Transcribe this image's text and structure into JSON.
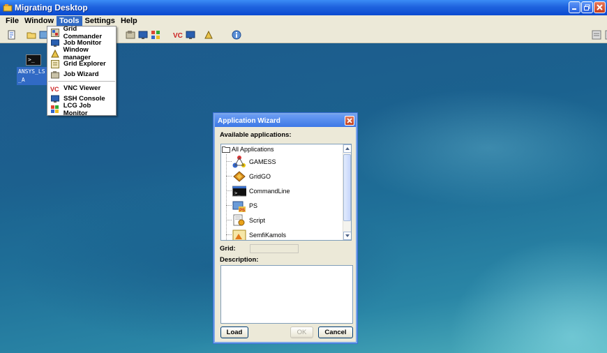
{
  "window": {
    "title": "Migrating Desktop"
  },
  "menubar": [
    {
      "label": "File"
    },
    {
      "label": "Window"
    },
    {
      "label": "Tools"
    },
    {
      "label": "Settings"
    },
    {
      "label": "Help"
    }
  ],
  "desktop": {
    "icon_label": "ANSYS_LS_A"
  },
  "tools_menu": {
    "items": [
      {
        "label": "Grid Commander",
        "icon": "grid-commander-icon"
      },
      {
        "label": "Job Monitor",
        "icon": "job-monitor-icon"
      },
      {
        "label": "Window manager",
        "icon": "window-manager-icon"
      },
      {
        "label": "Grid Explorer",
        "icon": "grid-explorer-icon"
      },
      {
        "label": "Job Wizard",
        "icon": "job-wizard-icon"
      },
      {
        "label": "VNC Viewer",
        "icon": "vnc-viewer-icon"
      },
      {
        "label": "SSH Console",
        "icon": "ssh-console-icon"
      },
      {
        "label": "LCG Job Monitor",
        "icon": "lcg-job-monitor-icon"
      }
    ]
  },
  "wizard": {
    "title": "Application Wizard",
    "available_label": "Available applications:",
    "tree_root": "All Applications",
    "applications": [
      {
        "label": "GAMESS",
        "icon": "gamess-icon"
      },
      {
        "label": "GridGO",
        "icon": "gridgo-icon"
      },
      {
        "label": "CommandLine",
        "icon": "commandline-icon"
      },
      {
        "label": "PS",
        "icon": "ps-icon"
      },
      {
        "label": "Script",
        "icon": "script-icon"
      },
      {
        "label": "SemfiKamols",
        "icon": "semfikamols-icon"
      }
    ],
    "grid_label": "Grid:",
    "grid_value": "",
    "description_label": "Description:",
    "description_value": "",
    "load_label": "Load",
    "ok_label": "OK",
    "cancel_label": "Cancel"
  }
}
